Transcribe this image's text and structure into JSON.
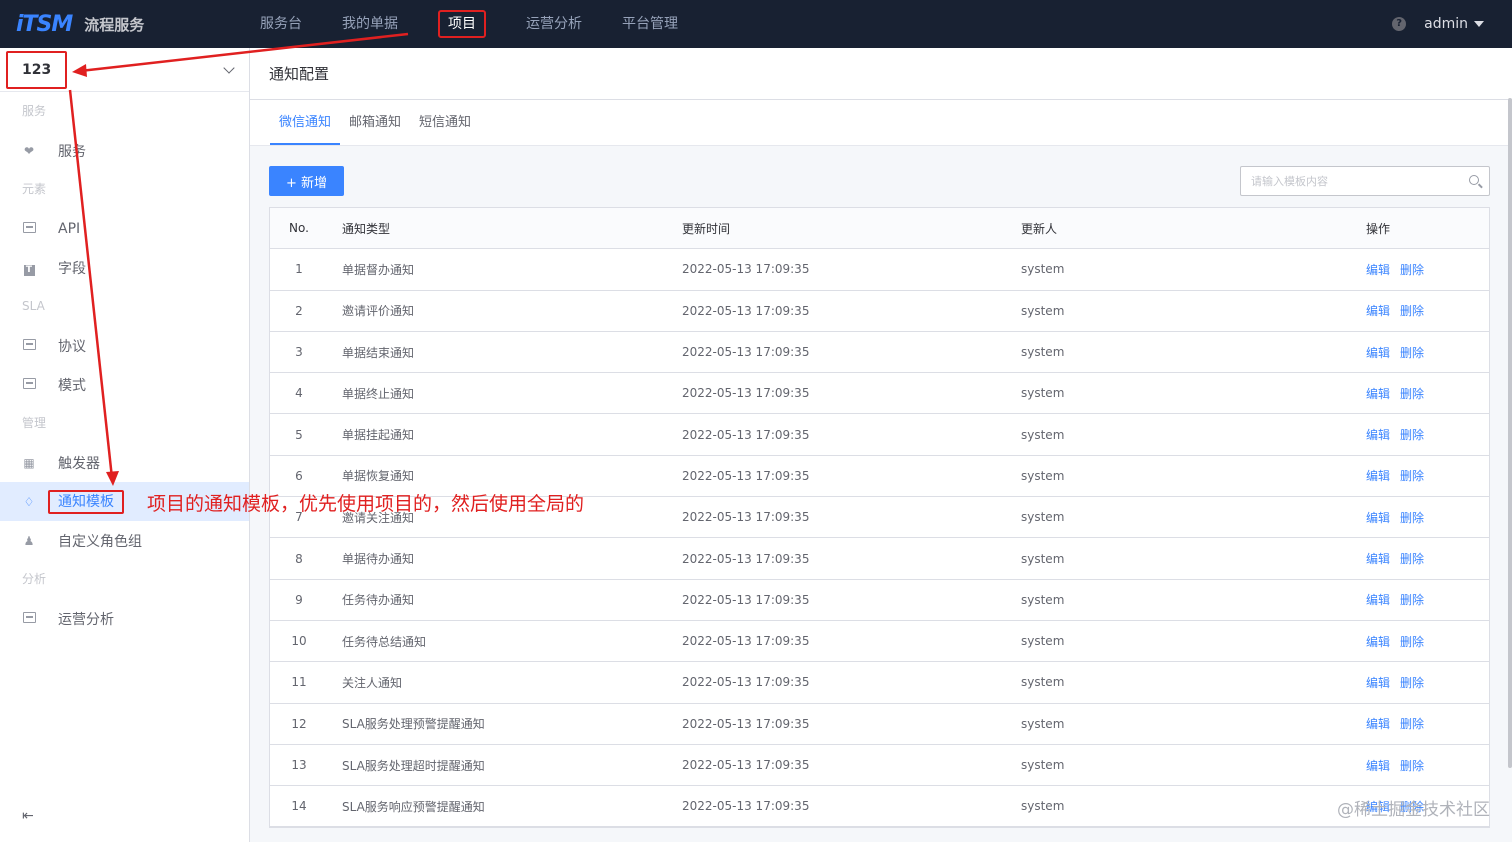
{
  "header": {
    "logo": "iTSM",
    "app_name": "流程服务",
    "nav": [
      {
        "label": "服务台"
      },
      {
        "label": "我的单据"
      },
      {
        "label": "项目"
      },
      {
        "label": "运营分析"
      },
      {
        "label": "平台管理"
      }
    ],
    "help_glyph": "?",
    "user": "admin"
  },
  "sidebar": {
    "project": "123",
    "groups": {
      "service": "服务",
      "element": "元素",
      "sla": "SLA",
      "manage": "管理",
      "analysis": "分析"
    },
    "items": {
      "service": "服务",
      "api": "API",
      "field": "字段",
      "agreement": "协议",
      "mode": "模式",
      "trigger": "触发器",
      "notify": "通知模板",
      "role": "自定义角色组",
      "ops": "运营分析"
    },
    "collapse_glyph": "⇤"
  },
  "page": {
    "title": "通知配置",
    "tabs": [
      {
        "label": "微信通知"
      },
      {
        "label": "邮箱通知"
      },
      {
        "label": "短信通知"
      }
    ],
    "add_button": "+ 新增",
    "search_placeholder": "请输入模板内容"
  },
  "table": {
    "headers": {
      "no": "No.",
      "type": "通知类型",
      "time": "更新时间",
      "user": "更新人",
      "op": "操作"
    },
    "edit_label": "编辑",
    "delete_label": "删除",
    "rows": [
      {
        "no": "1",
        "type": "单据督办通知",
        "time": "2022-05-13 17:09:35",
        "user": "system"
      },
      {
        "no": "2",
        "type": "邀请评价通知",
        "time": "2022-05-13 17:09:35",
        "user": "system"
      },
      {
        "no": "3",
        "type": "单据结束通知",
        "time": "2022-05-13 17:09:35",
        "user": "system"
      },
      {
        "no": "4",
        "type": "单据终止通知",
        "time": "2022-05-13 17:09:35",
        "user": "system"
      },
      {
        "no": "5",
        "type": "单据挂起通知",
        "time": "2022-05-13 17:09:35",
        "user": "system"
      },
      {
        "no": "6",
        "type": "单据恢复通知",
        "time": "2022-05-13 17:09:35",
        "user": "system"
      },
      {
        "no": "7",
        "type": "邀请关注通知",
        "time": "2022-05-13 17:09:35",
        "user": "system"
      },
      {
        "no": "8",
        "type": "单据待办通知",
        "time": "2022-05-13 17:09:35",
        "user": "system"
      },
      {
        "no": "9",
        "type": "任务待办通知",
        "time": "2022-05-13 17:09:35",
        "user": "system"
      },
      {
        "no": "10",
        "type": "任务待总结通知",
        "time": "2022-05-13 17:09:35",
        "user": "system"
      },
      {
        "no": "11",
        "type": "关注人通知",
        "time": "2022-05-13 17:09:35",
        "user": "system"
      },
      {
        "no": "12",
        "type": "SLA服务处理预警提醒通知",
        "time": "2022-05-13 17:09:35",
        "user": "system"
      },
      {
        "no": "13",
        "type": "SLA服务处理超时提醒通知",
        "time": "2022-05-13 17:09:35",
        "user": "system"
      },
      {
        "no": "14",
        "type": "SLA服务响应预警提醒通知",
        "time": "2022-05-13 17:09:35",
        "user": "system"
      }
    ]
  },
  "annotation": "项目的通知模板，优先使用项目的，然后使用全局的",
  "watermark": "@稀土掘金技术社区",
  "colors": {
    "primary": "#3a84ff",
    "topbar": "#182132",
    "annotation": "#e02020"
  }
}
